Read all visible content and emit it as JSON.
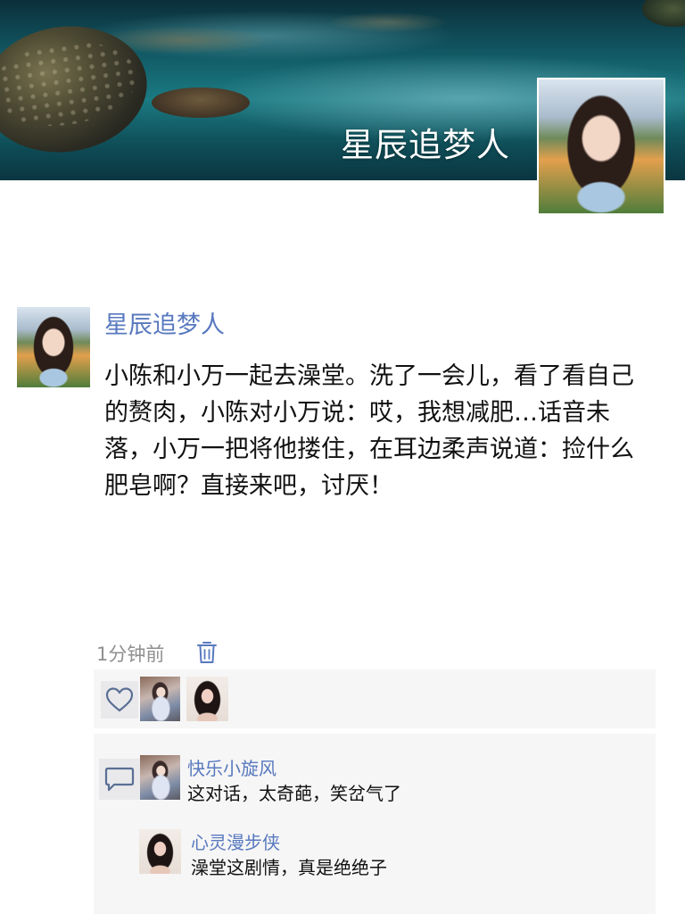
{
  "cover": {
    "title": "星辰追梦人"
  },
  "post": {
    "author": "星辰追梦人",
    "content": "小陈和小万一起去澡堂。洗了一会儿，看了看自己的赘肉，小陈对小万说：哎，我想减肥…话音未落，小万一把将他搂住，在耳边柔声说道：捡什么肥皂啊？直接来吧，讨厌！",
    "time": "1分钟前"
  },
  "likes": {
    "icon": "heart-outline-icon"
  },
  "comments": {
    "icon": "comment-bubble-icon",
    "items": [
      {
        "author": "快乐小旋风",
        "text": "这对话，太奇葩，笑岔气了"
      },
      {
        "author": "心灵漫步侠",
        "text": "澡堂这剧情，真是绝绝子"
      }
    ]
  },
  "colors": {
    "name_link": "#5879bf",
    "panel_bg": "#f6f6f6",
    "icon_box_bg": "#e9e9ec",
    "time_gray": "#8f8f8f"
  }
}
